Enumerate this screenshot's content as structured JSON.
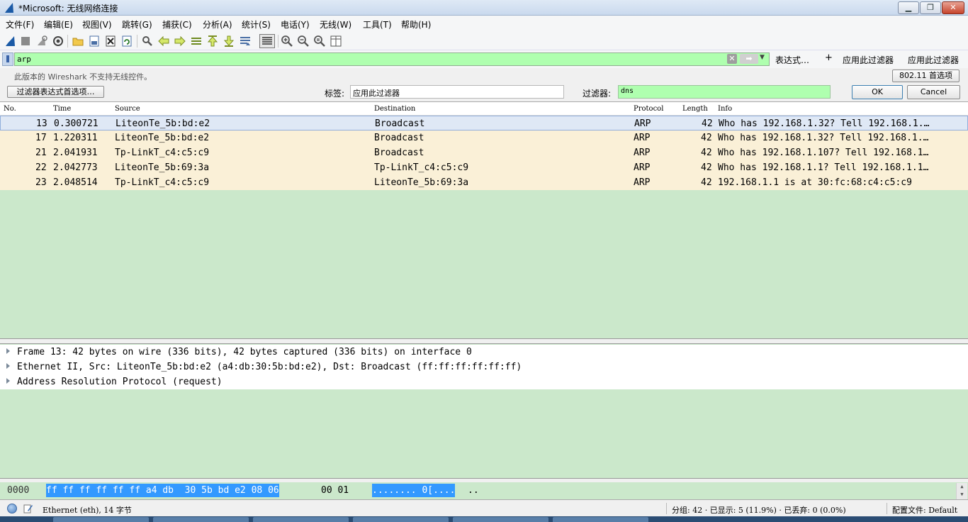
{
  "window": {
    "title": "*Microsoft: 无线网络连接",
    "min_label": "▁",
    "max_label": "❐",
    "close_label": "✕"
  },
  "menu": [
    "文件(F)",
    "编辑(E)",
    "视图(V)",
    "跳转(G)",
    "捕获(C)",
    "分析(A)",
    "统计(S)",
    "电话(Y)",
    "无线(W)",
    "工具(T)",
    "帮助(H)"
  ],
  "filter": {
    "value": "arp",
    "expression_label": "表达式…",
    "plus_label": "+",
    "apply_label_1": "应用此过滤器",
    "apply_label_2": "应用此过滤器"
  },
  "info": {
    "message": "此版本的 Wireshark 不支持无线控件。",
    "prefs_button": "802.11 首选项"
  },
  "edit": {
    "prefs_button": "过滤器表达式首选项…",
    "label_caption": "标签:",
    "label_value": "应用此过滤器",
    "filter_caption": "过滤器:",
    "filter_value": "dns",
    "ok": "OK",
    "cancel": "Cancel"
  },
  "packet_list": {
    "columns": [
      "No.",
      "Time",
      "Source",
      "Destination",
      "Protocol",
      "Length",
      "Info"
    ],
    "rows": [
      [
        "13",
        "0.300721",
        "LiteonTe_5b:bd:e2",
        "Broadcast",
        "ARP",
        "42",
        "Who has 192.168.1.32? Tell 192.168.1.…"
      ],
      [
        "17",
        "1.220311",
        "LiteonTe_5b:bd:e2",
        "Broadcast",
        "ARP",
        "42",
        "Who has 192.168.1.32? Tell 192.168.1.…"
      ],
      [
        "21",
        "2.041931",
        "Tp-LinkT_c4:c5:c9",
        "Broadcast",
        "ARP",
        "42",
        "Who has 192.168.1.107? Tell 192.168.1…"
      ],
      [
        "22",
        "2.042773",
        "LiteonTe_5b:69:3a",
        "Tp-LinkT_c4:c5:c9",
        "ARP",
        "42",
        "Who has 192.168.1.1? Tell 192.168.1.1…"
      ],
      [
        "23",
        "2.048514",
        "Tp-LinkT_c4:c5:c9",
        "LiteonTe_5b:69:3a",
        "ARP",
        "42",
        "192.168.1.1 is at 30:fc:68:c4:c5:c9"
      ]
    ],
    "row_colors": {
      "arp": "#faf0d7",
      "selected": "#dfe8f5",
      "background": "#cbe8cb"
    }
  },
  "details": [
    "Frame 13: 42 bytes on wire (336 bits), 42 bytes captured (336 bits) on interface 0",
    "Ethernet II, Src: LiteonTe_5b:bd:e2 (a4:db:30:5b:bd:e2), Dst: Broadcast (ff:ff:ff:ff:ff:ff)",
    "Address Resolution Protocol (request)"
  ],
  "bytes": {
    "offset": "0000",
    "hex_highlight": "ff ff ff ff ff ff a4 db  30 5b bd e2 08 06",
    "hex_rest": "00 01",
    "ascii_highlight": "........ 0[....",
    "ascii_rest": ".."
  },
  "status": {
    "field": "Ethernet (eth), 14 字节",
    "packets": "分组: 42 · 已显示: 5 (11.9%) · 已丢弃: 0 (0.0%)",
    "profile": "配置文件: Default"
  }
}
